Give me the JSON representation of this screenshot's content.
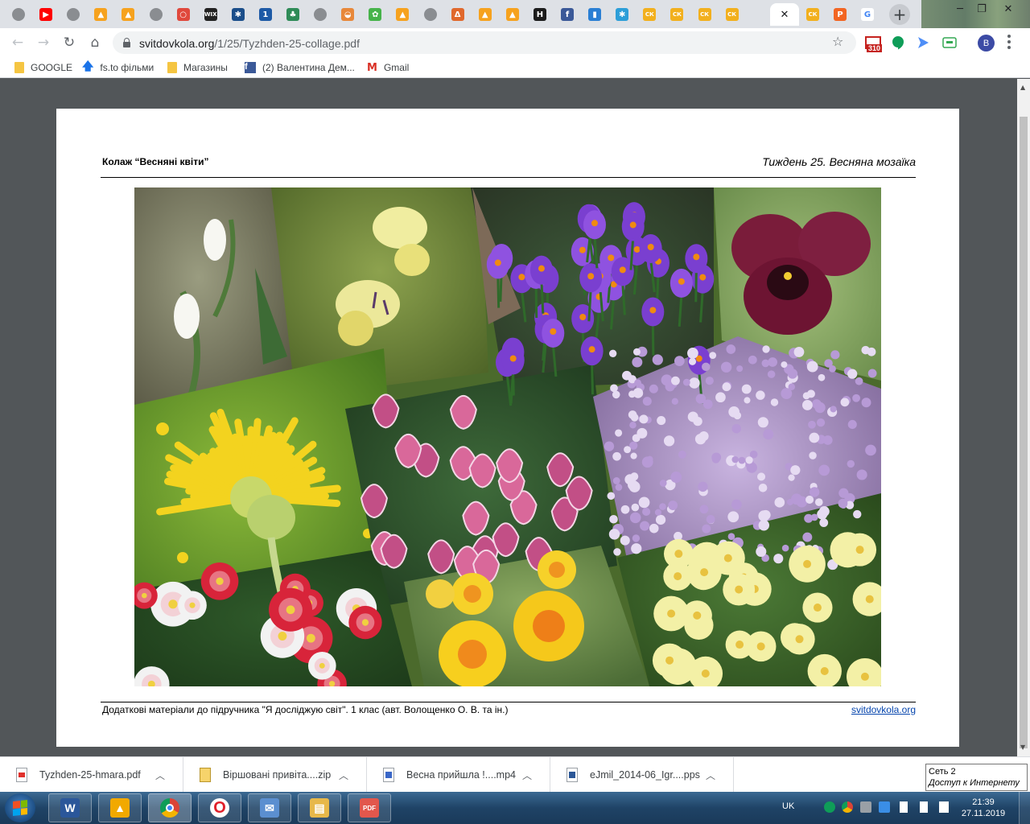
{
  "browser": {
    "tabs": [
      {
        "icon": "globe-icon",
        "color": "#8a8d91",
        "glyph": ""
      },
      {
        "icon": "youtube-icon",
        "color": "#ff0000",
        "glyph": "▶"
      },
      {
        "icon": "globe-icon",
        "color": "#8a8d91",
        "glyph": ""
      },
      {
        "icon": "bell-icon",
        "color": "#f6a21e",
        "glyph": "▲"
      },
      {
        "icon": "bell-icon",
        "color": "#f6a21e",
        "glyph": "▲"
      },
      {
        "icon": "globe-icon",
        "color": "#8a8d91",
        "glyph": ""
      },
      {
        "icon": "opera-like-icon",
        "color": "#e0483c",
        "glyph": "○"
      },
      {
        "icon": "wix-icon",
        "color": "#222222",
        "glyph": "WIX"
      },
      {
        "icon": "snowflake-icon",
        "color": "#1b4e8a",
        "glyph": "✱"
      },
      {
        "icon": "channel-one-icon",
        "color": "#1d5aa6",
        "glyph": "1"
      },
      {
        "icon": "tree-icon",
        "color": "#2e8b57",
        "glyph": "♣"
      },
      {
        "icon": "globe-icon",
        "color": "#8a8d91",
        "glyph": ""
      },
      {
        "icon": "rainbow-icon",
        "color": "#e8883a",
        "glyph": "◒"
      },
      {
        "icon": "flower-icon",
        "color": "#46b34a",
        "glyph": "✿"
      },
      {
        "icon": "bell-icon",
        "color": "#f6a21e",
        "glyph": "▲"
      },
      {
        "icon": "globe-icon",
        "color": "#8a8d91",
        "glyph": ""
      },
      {
        "icon": "triangle-icon",
        "color": "#e0682c",
        "glyph": "Δ"
      },
      {
        "icon": "bell-icon",
        "color": "#f6a21e",
        "glyph": "▲"
      },
      {
        "icon": "bell-icon",
        "color": "#f6a21e",
        "glyph": "▲"
      },
      {
        "icon": "h-icon",
        "color": "#1c1c1c",
        "glyph": "H"
      },
      {
        "icon": "facebook-icon",
        "color": "#3b5998",
        "glyph": "f"
      },
      {
        "icon": "bar-chart-icon",
        "color": "#2a7fd4",
        "glyph": "▮"
      },
      {
        "icon": "snowflake-icon",
        "color": "#2c9ed8",
        "glyph": "✱"
      },
      {
        "icon": "svitdovkola-icon",
        "color": "#f2b01e",
        "glyph": "СК"
      },
      {
        "icon": "svitdovkola-icon",
        "color": "#f2b01e",
        "glyph": "СК"
      },
      {
        "icon": "svitdovkola-icon",
        "color": "#f2b01e",
        "glyph": "СК"
      },
      {
        "icon": "svitdovkola-icon",
        "color": "#f2b01e",
        "glyph": "СК"
      }
    ],
    "tabs_after": [
      {
        "icon": "svitdovkola-icon",
        "color": "#f2b01e",
        "glyph": "СК"
      },
      {
        "icon": "p-icon",
        "color": "#f26522",
        "glyph": "P"
      },
      {
        "icon": "google-icon",
        "color": "#4285f4",
        "glyph": "G"
      }
    ],
    "active_tab_close": "✕",
    "new_tab": "+",
    "url_host": "svitdovkola.org",
    "url_path": "/1/25/Tyzhden-25-collage.pdf",
    "gmail_badge": "310",
    "profile_initial": "B"
  },
  "bookmarks": [
    {
      "label": "GOOGLE",
      "icon": "folder-icon"
    },
    {
      "label": "fs.to фільми",
      "icon": "arrow-up-icon"
    },
    {
      "label": "Магазины",
      "icon": "folder-icon"
    },
    {
      "label": "(2) Валентина Дем...",
      "icon": "facebook-icon"
    },
    {
      "label": "Gmail",
      "icon": "gmail-icon"
    }
  ],
  "pdf": {
    "header_left": "Колаж “Весняні квіти”",
    "header_right": "Тиждень 25. Весняна мозаїка",
    "footer_left": "Додаткові матеріали до підручника \"Я досліджую світ\". 1 клас (авт. Волощенко О. В. та ін.)",
    "footer_right": "svitdovkola.org",
    "collage_flowers": [
      "snowdrops",
      "violas",
      "crocuses",
      "pansy",
      "dandelion",
      "tulips",
      "lilac",
      "daisies",
      "daffodils",
      "primroses"
    ]
  },
  "downloads": [
    {
      "name": "Tyzhden-25-hmara.pdf",
      "type": "pdf"
    },
    {
      "name": "Віршовані привіта....zip",
      "type": "zip"
    },
    {
      "name": "Весна прийшла !....mp4",
      "type": "mp4"
    },
    {
      "name": "eJmil_2014-06_Igr....pps",
      "type": "pps"
    }
  ],
  "network_tooltip": {
    "line1": "Сеть  2",
    "line2": "Доступ к Интернету"
  },
  "taskbar": {
    "apps": [
      {
        "name": "word-icon",
        "glyph": "W",
        "color": "#2b579a"
      },
      {
        "name": "aimp-icon",
        "glyph": "▲",
        "color": "#f2a900"
      },
      {
        "name": "chrome-icon",
        "glyph": "",
        "color": "#4285f4"
      },
      {
        "name": "opera-icon",
        "glyph": "O",
        "color": "#e0202a"
      },
      {
        "name": "messenger-icon",
        "glyph": "✉",
        "color": "#5b8fd0"
      },
      {
        "name": "explorer-icon",
        "glyph": "▤",
        "color": "#e7b84a"
      },
      {
        "name": "pdf-icon",
        "glyph": "PDF",
        "color": "#e2574c"
      }
    ],
    "lang": "UK",
    "time": "21:39",
    "date": "27.11.2019"
  }
}
